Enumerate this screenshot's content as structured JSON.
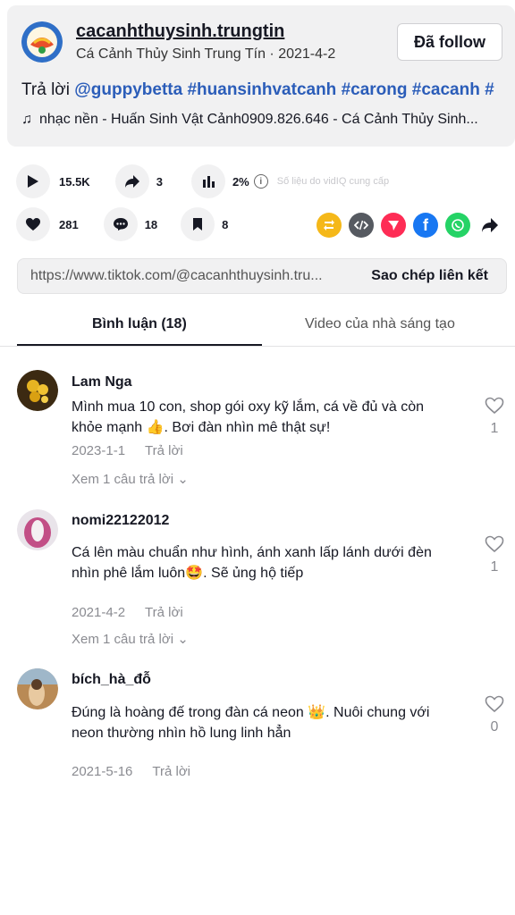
{
  "header": {
    "username": "cacanhthuysinh.trungtin",
    "subline": "Cá Cảnh Thủy Sinh Trung Tín · 2021-4-2",
    "follow_label": "Đã follow",
    "caption_prefix": "Trả lời ",
    "caption_tags": [
      "@guppybetta",
      "#huansinhvatcanh",
      "#carong",
      "#cacanh",
      "#"
    ],
    "music": "nhạc nền - Huấn Sinh Vật Cảnh0909.826.646 - Cá Cảnh Thủy Sinh..."
  },
  "stats": {
    "plays": "15.5K",
    "shares": "3",
    "percent": "2%",
    "provided_by": "Số liệu do vidIQ cung cấp",
    "likes": "281",
    "comments": "18",
    "saves": "8"
  },
  "share_icons": [
    {
      "name": "repost-icon",
      "color": "#f5b819"
    },
    {
      "name": "embed-icon",
      "color": "#565a61"
    },
    {
      "name": "send-icon",
      "color": "#fe2c55"
    },
    {
      "name": "facebook-icon",
      "color": "#1877f2"
    },
    {
      "name": "whatsapp-icon",
      "color": "#25d366"
    },
    {
      "name": "share-arrow-icon",
      "color": "#161823"
    }
  ],
  "link": {
    "url": "https://www.tiktok.com/@cacanhthuysinh.tru...",
    "copy_label": "Sao chép liên kết"
  },
  "tabs": {
    "comments": "Bình luận (18)",
    "creator_videos": "Video của nhà sáng tạo"
  },
  "comments": [
    {
      "user": "Lam Nga",
      "text": "Mình mua 10 con, shop gói oxy kỹ lắm, cá về đủ và còn khỏe mạnh 👍. Bơi đàn nhìn mê thật sự!",
      "date": "2023-1-1",
      "reply": "Trả lời",
      "more": "Xem 1 câu trả lời",
      "likes": "1"
    },
    {
      "user": "nomi22122012",
      "text": "Cá lên màu chuẩn như hình, ánh xanh lấp lánh dưới đèn nhìn phê lắm luôn🤩. Sẽ ủng hộ tiếp",
      "date": "2021-4-2",
      "reply": "Trả lời",
      "more": "Xem 1 câu trả lời",
      "likes": "1"
    },
    {
      "user": "bích_hà_đỗ",
      "text": "Đúng là hoàng đế trong đàn cá neon 👑. Nuôi chung với neon thường nhìn hồ lung linh hẳn",
      "date": "2021-5-16",
      "reply": "Trả lời",
      "likes": "0"
    }
  ]
}
